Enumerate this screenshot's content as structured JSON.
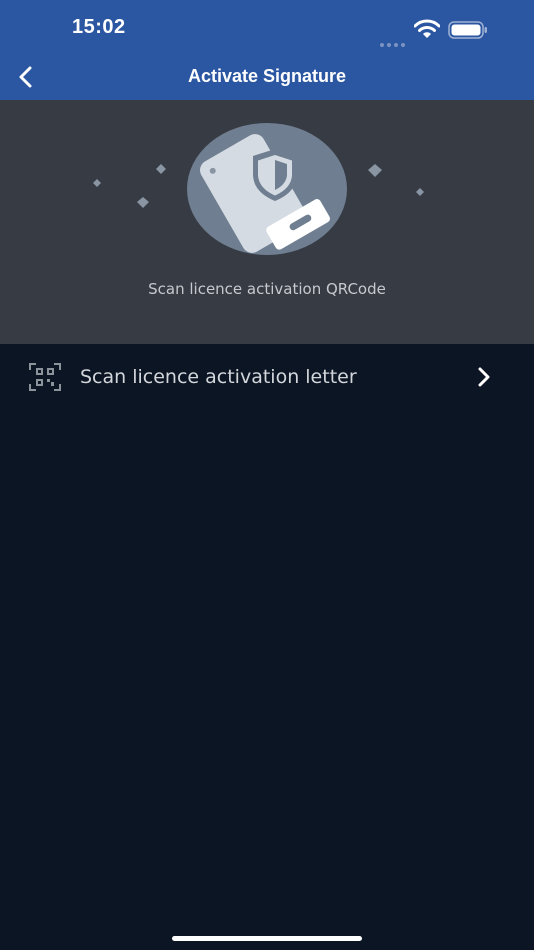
{
  "status_bar": {
    "time": "15:02",
    "icons": [
      "signal-dots-icon",
      "wifi-icon",
      "battery-icon"
    ]
  },
  "nav": {
    "title": "Activate Signature",
    "back_icon": "chevron-left-icon"
  },
  "hero": {
    "illustration": "phone-shield-icon",
    "caption": "Scan licence activation QRCode"
  },
  "list": {
    "items": [
      {
        "icon": "qr-code-icon",
        "label": "Scan licence activation letter",
        "trailing_icon": "chevron-right-icon"
      }
    ]
  },
  "colors": {
    "header": "#2b56a1",
    "hero_bg": "#373b44",
    "page_bg": "#0c1523",
    "illustration_circle": "#6f7e90",
    "text_primary": "#ffffff",
    "text_secondary": "#c6c9ce"
  }
}
